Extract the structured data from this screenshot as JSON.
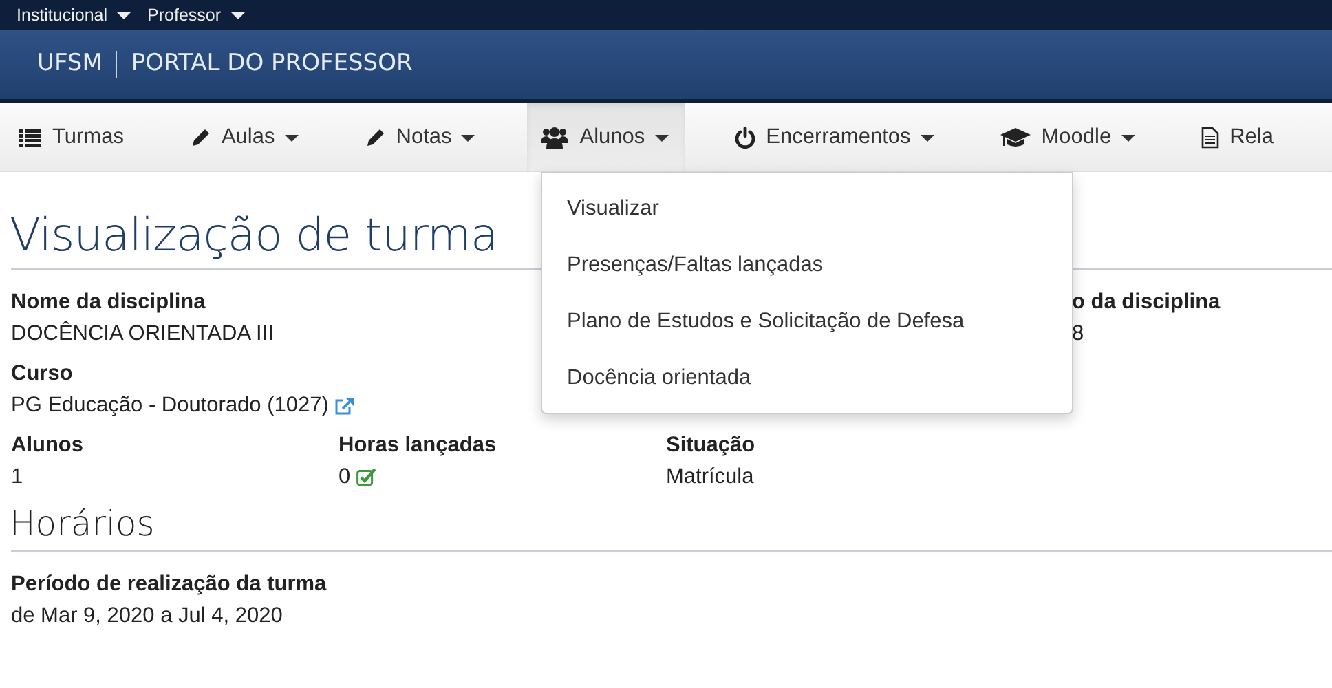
{
  "top_menu": [
    {
      "label": "Institucional"
    },
    {
      "label": "Professor"
    }
  ],
  "brand": {
    "name": "UFSM",
    "title": "PORTAL DO PROFESSOR"
  },
  "nav": [
    {
      "label": "Turmas",
      "caret": false,
      "selected": false
    },
    {
      "label": "Aulas",
      "caret": true,
      "selected": false
    },
    {
      "label": "Notas",
      "caret": true,
      "selected": false
    },
    {
      "label": "Alunos",
      "caret": true,
      "selected": true
    },
    {
      "label": "Encerramentos",
      "caret": true,
      "selected": false
    },
    {
      "label": "Moodle",
      "caret": true,
      "selected": false
    },
    {
      "label": "Rela",
      "caret": false,
      "selected": false
    }
  ],
  "dropdown_menu": {
    "items": [
      "Visualizar",
      "Presenças/Faltas lançadas",
      "Plano de Estudos e Solicitação de Defesa",
      "Docência orientada"
    ]
  },
  "page_title": "Visualização de turma",
  "field_rows": [
    [
      {
        "label": "Nome da disciplina",
        "value": "DOCÊNCIA ORIENTADA III"
      },
      {
        "label": "o da disciplina",
        "value": "8"
      }
    ],
    [
      {
        "label": "Curso",
        "value": "PG Educação - Doutorado (1027)",
        "kind": "link"
      }
    ],
    [
      {
        "label": "Alunos",
        "value": "1"
      },
      {
        "label": "Horas lançadas",
        "value": "0",
        "kind": "confirmed"
      },
      {
        "label": "Situação",
        "value": "Matrícula"
      }
    ]
  ],
  "sections": [
    {
      "title": "Horários",
      "fields": [
        {
          "label": "Período de realização da turma",
          "value": "de Mar 9, 2020 a Jul 4, 2020"
        }
      ]
    }
  ]
}
